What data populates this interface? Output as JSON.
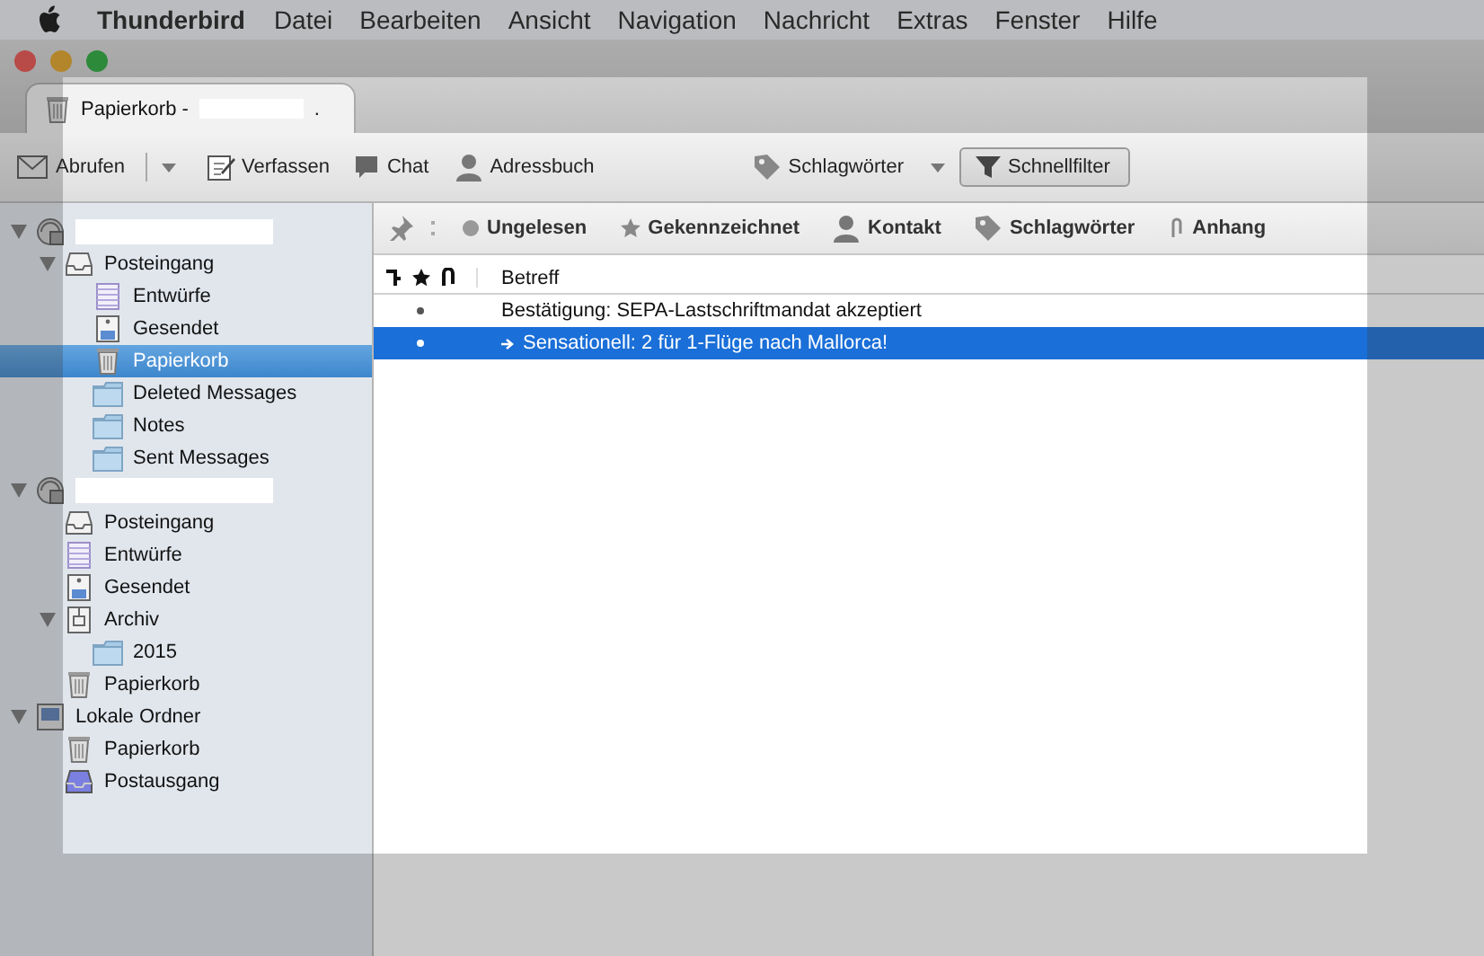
{
  "menu_bar": {
    "app": "Thunderbird",
    "items": [
      "Datei",
      "Bearbeiten",
      "Ansicht",
      "Navigation",
      "Nachricht",
      "Extras",
      "Fenster",
      "Hilfe"
    ]
  },
  "tabs": [
    {
      "label": "Papierkorb -",
      "suffix": ".",
      "selected": true
    }
  ],
  "toolbar": [
    {
      "label": "Abrufen",
      "kind": "mail",
      "dropdown": true,
      "selected": false
    },
    {
      "label": "Verfassen",
      "kind": "compose",
      "dropdown": false,
      "selected": false
    },
    {
      "label": "Chat",
      "kind": "chat",
      "dropdown": false,
      "selected": false
    },
    {
      "label": "Adressbuch",
      "kind": "contact",
      "dropdown": false,
      "selected": false
    },
    {
      "label": "Schlagwörter",
      "kind": "tag",
      "dropdown": true,
      "selected": false
    },
    {
      "label": "Schnellfilter",
      "kind": "filter",
      "dropdown": false,
      "selected": true
    }
  ],
  "folder_tree": [
    {
      "kind": "account",
      "name_redacted": true,
      "expanded": true,
      "selected": false,
      "children": [
        {
          "label": "Posteingang",
          "kind": "inbox",
          "expanded": true,
          "selected": false,
          "children": [
            {
              "label": "Entwürfe",
              "kind": "drafts",
              "selected": false
            },
            {
              "label": "Gesendet",
              "kind": "sent",
              "selected": false
            },
            {
              "label": "Papierkorb",
              "kind": "trash",
              "selected": true
            },
            {
              "label": "Deleted Messages",
              "kind": "folder",
              "selected": false
            },
            {
              "label": "Notes",
              "kind": "folder",
              "selected": false
            },
            {
              "label": "Sent Messages",
              "kind": "folder",
              "selected": false
            }
          ]
        }
      ]
    },
    {
      "kind": "account",
      "name_redacted": true,
      "expanded": true,
      "selected": false,
      "children": [
        {
          "label": "Posteingang",
          "kind": "inbox",
          "selected": false
        },
        {
          "label": "Entwürfe",
          "kind": "drafts",
          "selected": false
        },
        {
          "label": "Gesendet",
          "kind": "sent",
          "selected": false
        },
        {
          "label": "Archiv",
          "kind": "archive",
          "expanded": true,
          "selected": false,
          "children": [
            {
              "label": "2015",
              "kind": "folder",
              "selected": false
            }
          ]
        },
        {
          "label": "Papierkorb",
          "kind": "trash",
          "selected": false
        }
      ]
    },
    {
      "label": "Lokale Ordner",
      "kind": "local",
      "expanded": true,
      "selected": false,
      "children": [
        {
          "label": "Papierkorb",
          "kind": "trash",
          "selected": false
        },
        {
          "label": "Postausgang",
          "kind": "outbox",
          "selected": false
        }
      ]
    }
  ],
  "quick_filter": [
    {
      "label": "Ungelesen",
      "kind": "dot",
      "selected": false
    },
    {
      "label": "Gekennzeichnet",
      "kind": "star",
      "selected": false
    },
    {
      "label": "Kontakt",
      "kind": "contact",
      "selected": false
    },
    {
      "label": "Schlagwörter",
      "kind": "tag",
      "selected": false
    },
    {
      "label": "Anhang",
      "kind": "clip",
      "selected": false
    }
  ],
  "message_list": {
    "columns": [
      "Betreff"
    ],
    "rows": [
      {
        "subject": "Bestätigung: SEPA-Lastschriftmandat akzeptiert",
        "forwarded": false,
        "selected": false
      },
      {
        "subject": "Sensationell: 2 für 1-Flüge nach Mallorca!",
        "forwarded": true,
        "selected": true
      }
    ]
  }
}
